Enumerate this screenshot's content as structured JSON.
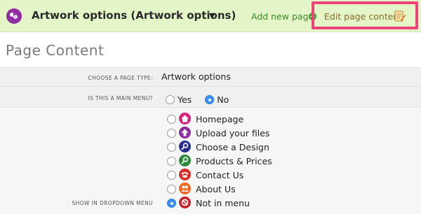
{
  "header": {
    "page_title": "Artwork options (Artwork options)",
    "dropdown_caret": "▼",
    "add_new_page": "Add new page",
    "edit_page_content": "Edit page content",
    "highlight_color": "#f0427a"
  },
  "main": {
    "heading": "Page Content",
    "page_type": {
      "label": "CHOOSE A PAGE TYPE:",
      "value": "Artwork options"
    },
    "main_menu": {
      "label": "IS THIS A MAIN MENU?",
      "options": [
        {
          "label": "Yes",
          "checked": false
        },
        {
          "label": "No",
          "checked": true
        }
      ]
    },
    "dropdown_menu": {
      "label": "SHOW IN DROPDOWN MENU",
      "items": [
        {
          "label": "Homepage",
          "icon": "home-icon",
          "color": "#d6247d",
          "checked": false
        },
        {
          "label": "Upload your files",
          "icon": "upload-icon",
          "color": "#8e2da0",
          "checked": false
        },
        {
          "label": "Choose a Design",
          "icon": "magnifier-icon",
          "color": "#28308f",
          "checked": false
        },
        {
          "label": "Products & Prices",
          "icon": "magnifier-icon",
          "color": "#2b8a3a",
          "checked": false
        },
        {
          "label": "Contact Us",
          "icon": "phone-icon",
          "color": "#d93026",
          "checked": false
        },
        {
          "label": "About Us",
          "icon": "people-icon",
          "color": "#ef6b22",
          "checked": false
        },
        {
          "label": "Not in menu",
          "icon": "no-entry-icon",
          "color": "#c9202f",
          "checked": true
        }
      ]
    }
  }
}
